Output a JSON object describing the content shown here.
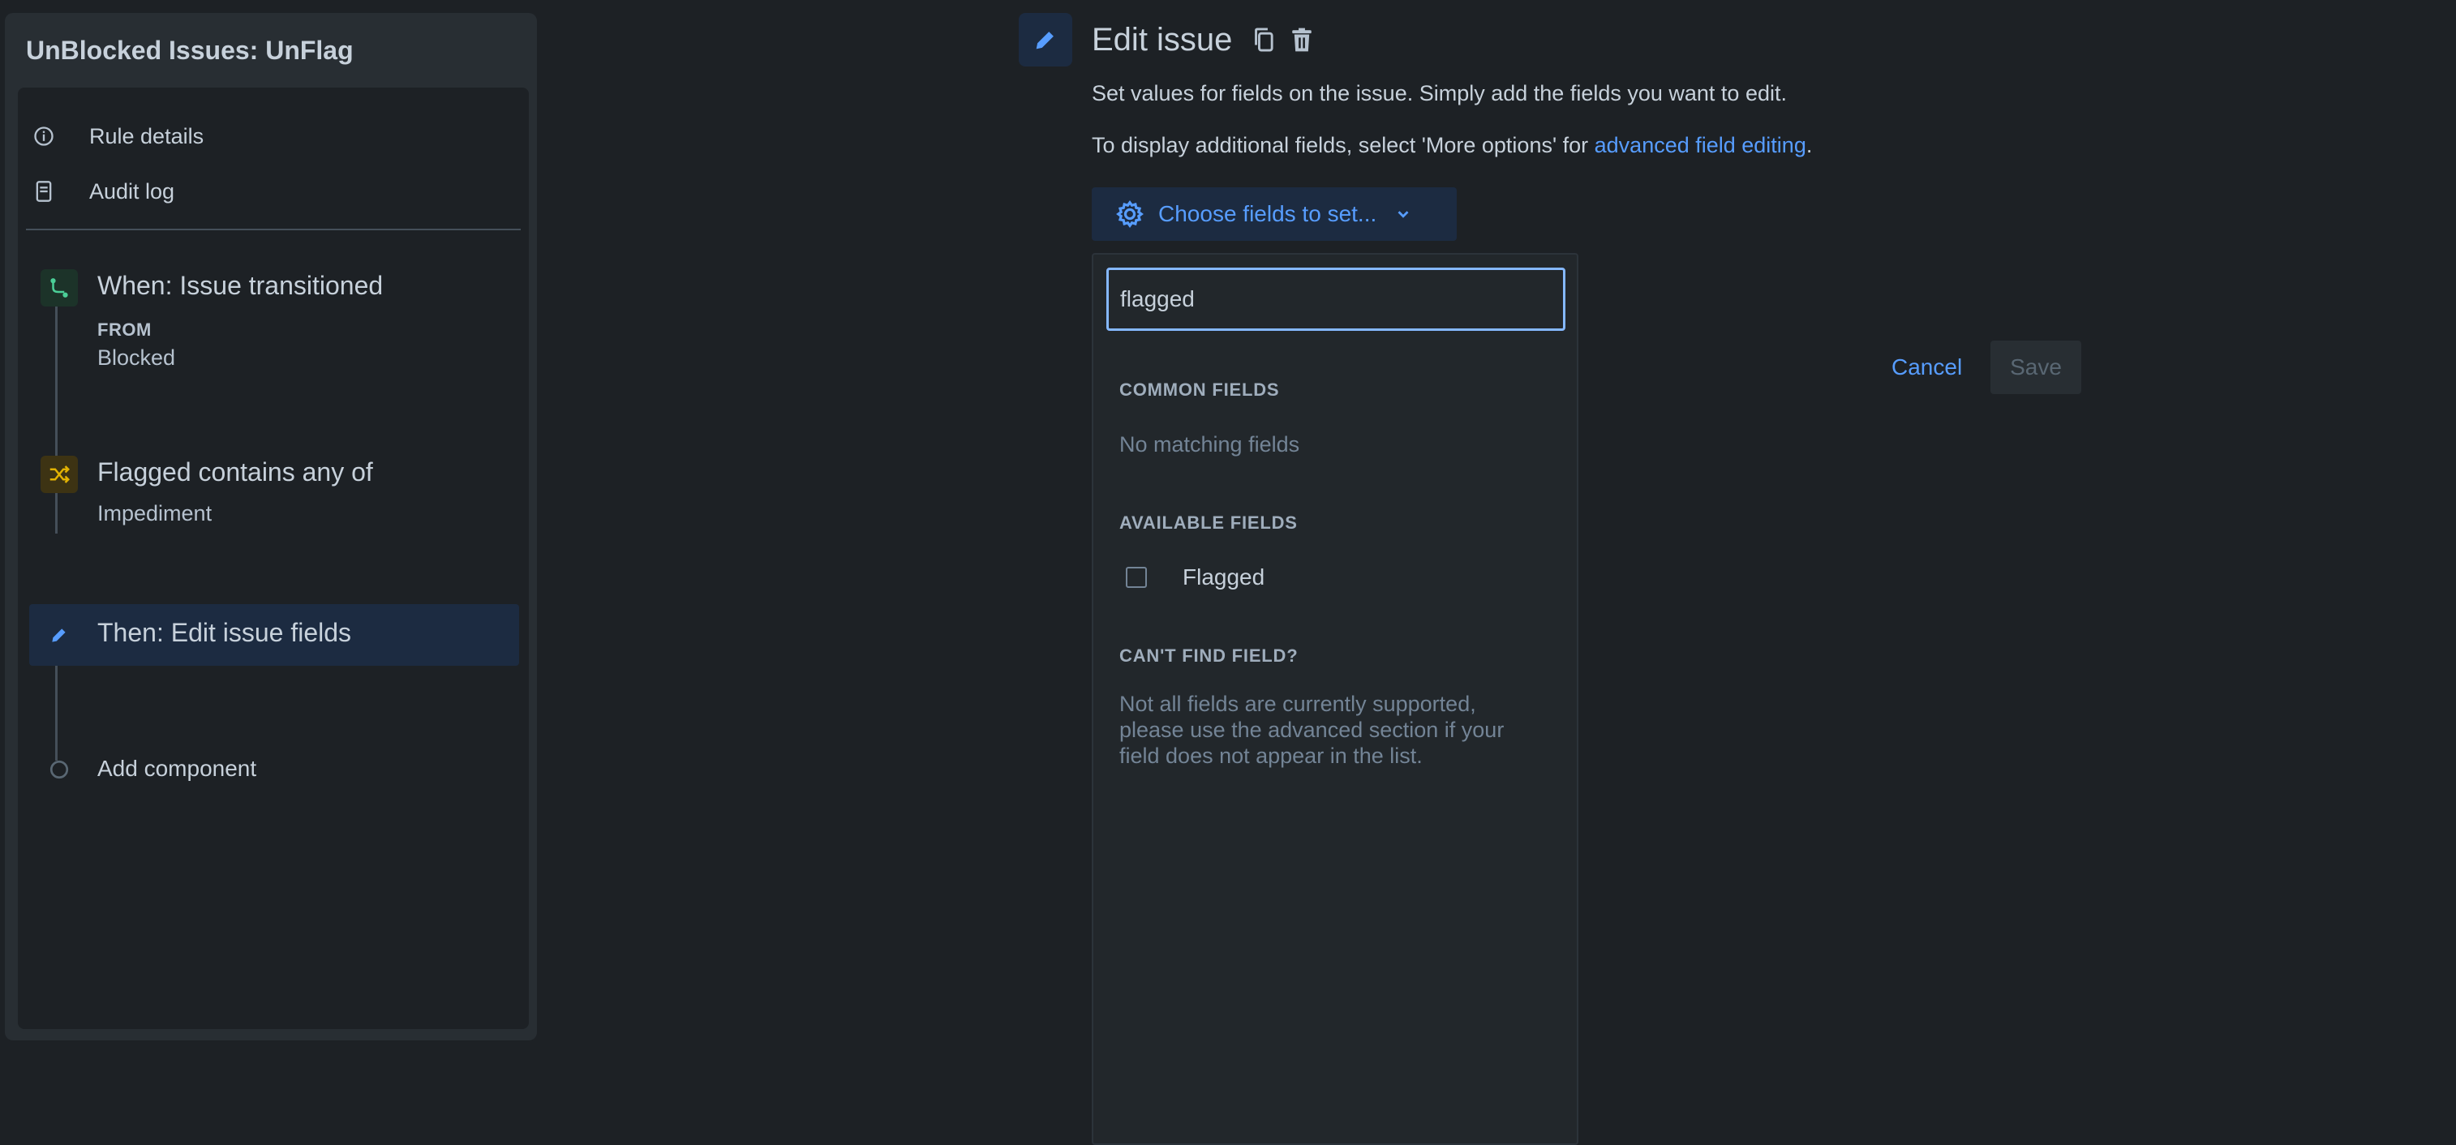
{
  "sidebar": {
    "title": "UnBlocked Issues: UnFlag",
    "nav": [
      {
        "label": "Rule details",
        "icon": "info-icon"
      },
      {
        "label": "Audit log",
        "icon": "document-icon"
      }
    ],
    "steps": {
      "trigger": {
        "title": "When: Issue transitioned",
        "sub_label": "FROM",
        "sub_value": "Blocked",
        "icon": "branch-icon",
        "color": "#4bce97"
      },
      "condition": {
        "title": "Flagged contains any of",
        "sub_value": "Impediment",
        "icon": "shuffle-icon",
        "color": "#e2b203"
      },
      "action": {
        "title": "Then: Edit issue fields",
        "icon": "pencil-icon",
        "color": "#579dff"
      },
      "add": {
        "label": "Add component"
      }
    }
  },
  "main": {
    "title": "Edit issue",
    "description": "Set values for fields on the issue. Simply add the fields you want to edit.",
    "more_prefix": "To display additional fields, select 'More options' for ",
    "more_link": "advanced field editing",
    "more_suffix": ".",
    "choose_button": "Choose fields to set...",
    "dropdown": {
      "search_value": "flagged",
      "common_heading": "COMMON FIELDS",
      "common_empty": "No matching fields",
      "available_heading": "AVAILABLE FIELDS",
      "available_items": [
        {
          "label": "Flagged",
          "checked": false
        }
      ],
      "cant_find_heading": "CAN'T FIND FIELD?",
      "cant_find_lines": [
        "Not all fields are currently supported,",
        "please use the advanced section if your",
        "field does not appear in the list."
      ]
    },
    "cancel": "Cancel",
    "save": "Save"
  }
}
